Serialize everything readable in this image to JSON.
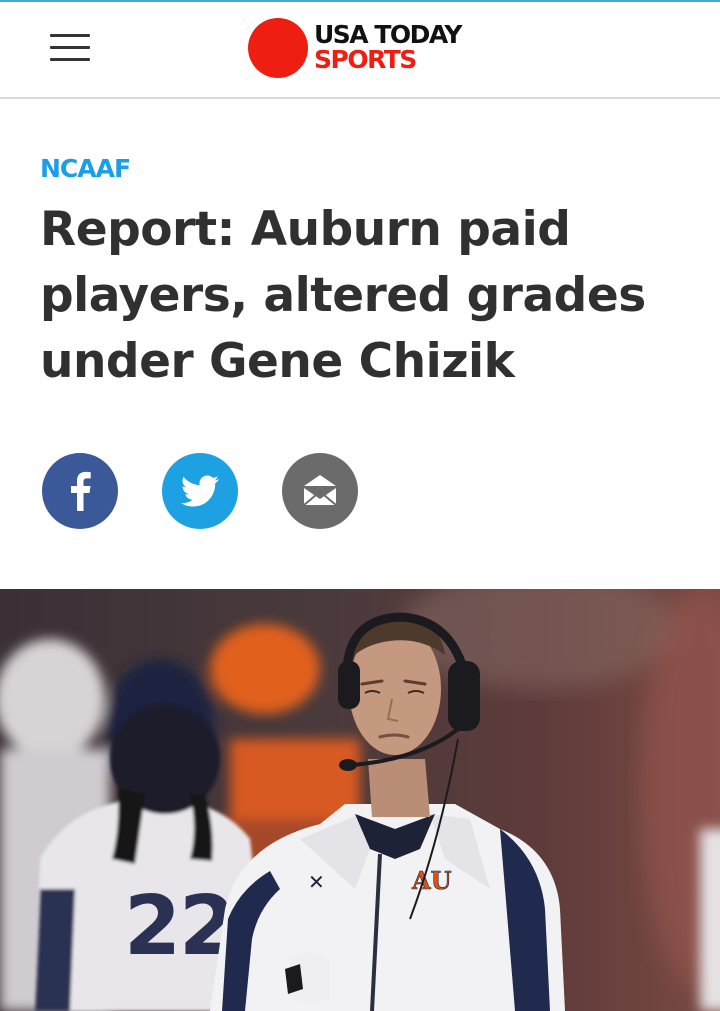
{
  "brand": {
    "line1": "USA TODAY",
    "line2": "SPORTS",
    "dot_color": "#ee1f12",
    "accent_color": "#ee1f12"
  },
  "header": {
    "menu_icon": "hamburger-menu-icon"
  },
  "article": {
    "section": "NCAAF",
    "section_color": "#1a9ee8",
    "headline": "Report: Auburn paid players, altered grades under Gene Chizik"
  },
  "share": {
    "facebook_icon": "facebook-icon",
    "facebook_color": "#3b5998",
    "twitter_icon": "twitter-icon",
    "twitter_color": "#1da1e3",
    "email_icon": "email-icon",
    "email_color": "#6b6b6b"
  },
  "photo": {
    "jersey_number": "22"
  }
}
